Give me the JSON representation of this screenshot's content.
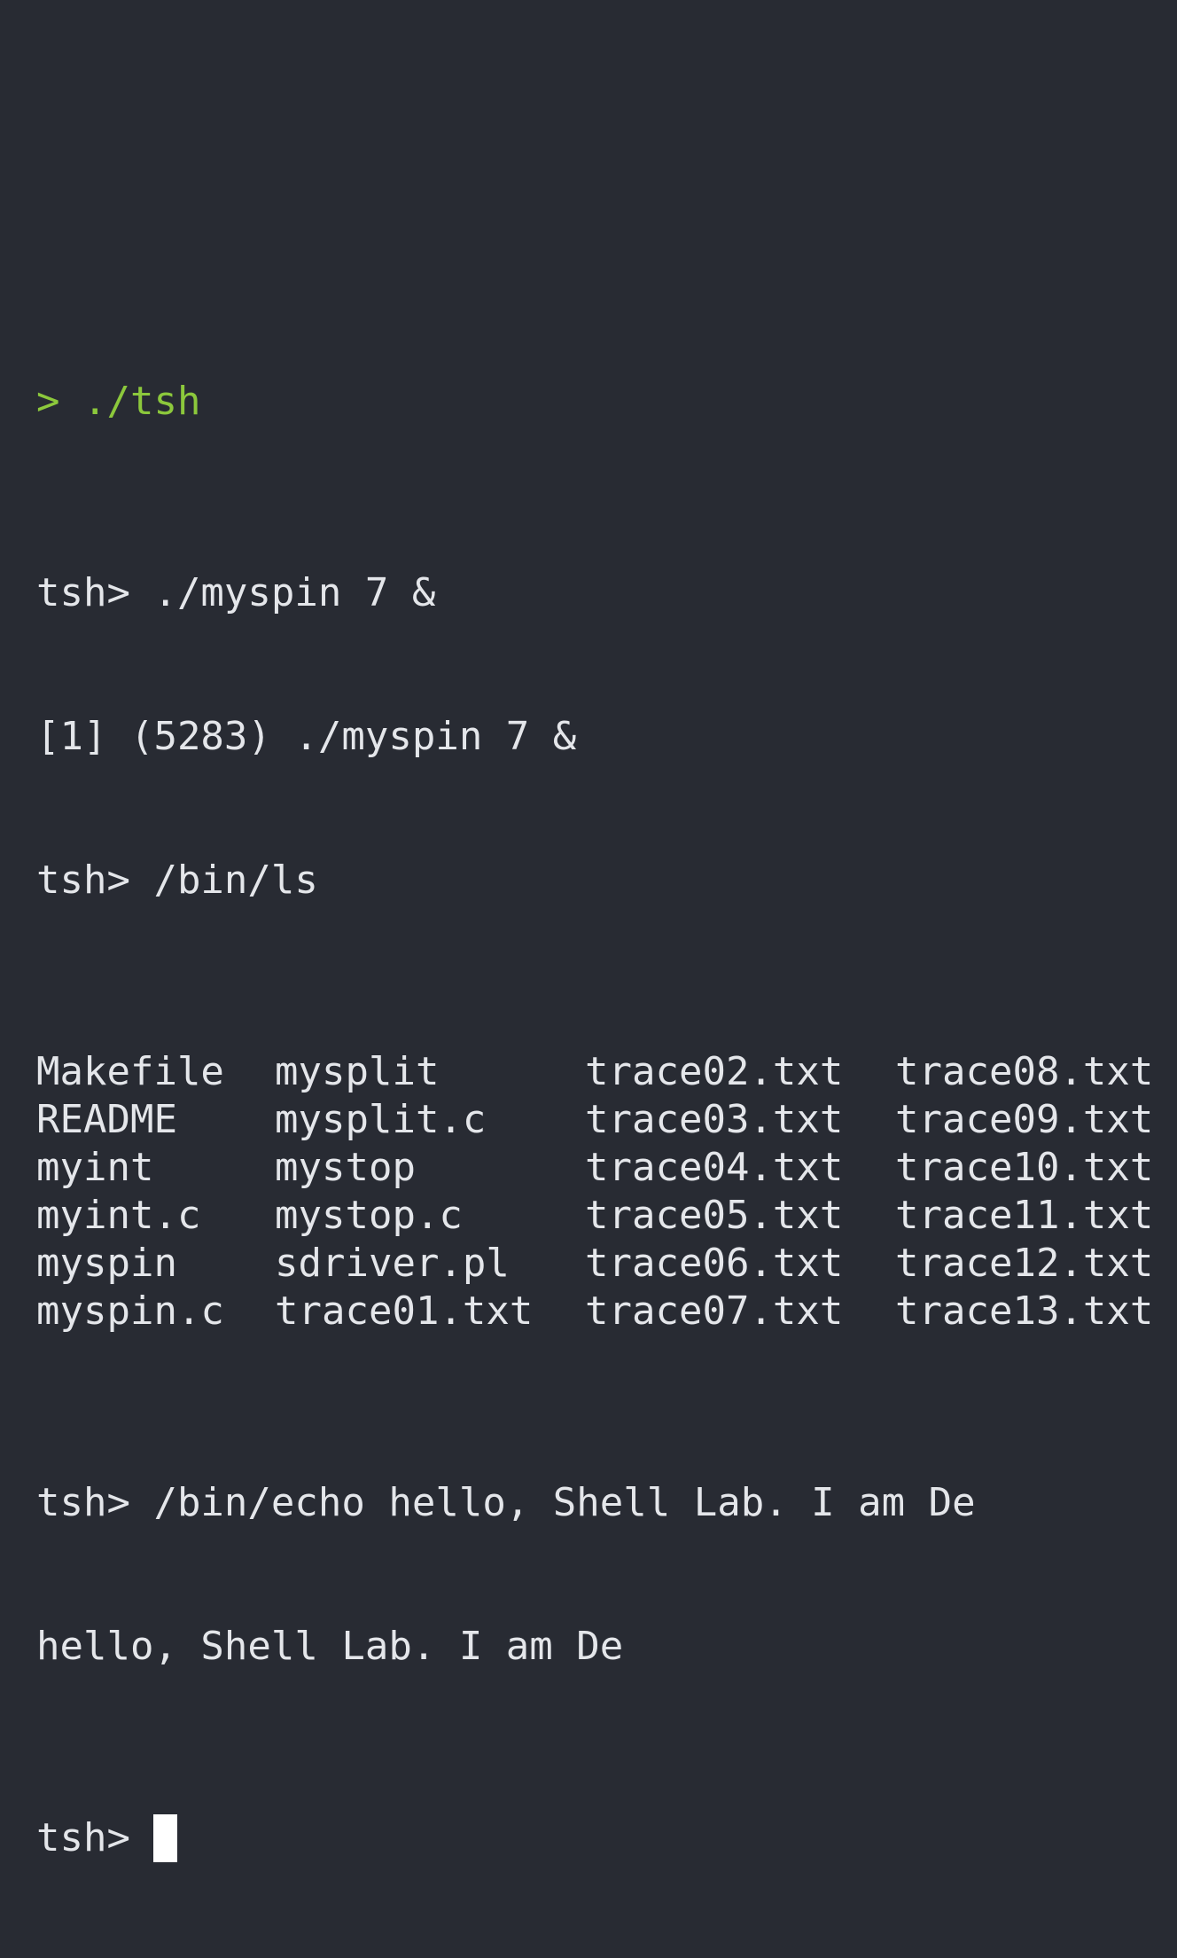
{
  "colors": {
    "background": "#282b33",
    "text": "#e4e6ea",
    "shell_prompt": "#8cc83c",
    "cursor": "#ffffff"
  },
  "terminal": {
    "shell_line": "> ./tsh",
    "lines_before_ls": [
      "tsh> ./myspin 7 &",
      "[1] (5283) ./myspin 7 &",
      "tsh> /bin/ls"
    ],
    "ls_rows": [
      [
        "Makefile",
        "mysplit",
        "trace02.txt",
        "trace08.txt"
      ],
      [
        "README",
        "mysplit.c",
        "trace03.txt",
        "trace09.txt"
      ],
      [
        "myint",
        "mystop",
        "trace04.txt",
        "trace10.txt"
      ],
      [
        "myint.c",
        "mystop.c",
        "trace05.txt",
        "trace11.txt"
      ],
      [
        "myspin",
        "sdriver.pl",
        "trace06.txt",
        "trace12.txt"
      ],
      [
        "myspin.c",
        "trace01.txt",
        "trace07.txt",
        "trace13.txt"
      ]
    ],
    "lines_after_ls": [
      "tsh> /bin/echo hello, Shell Lab. I am De",
      "hello, Shell Lab. I am De"
    ],
    "current_prompt": "tsh> "
  }
}
